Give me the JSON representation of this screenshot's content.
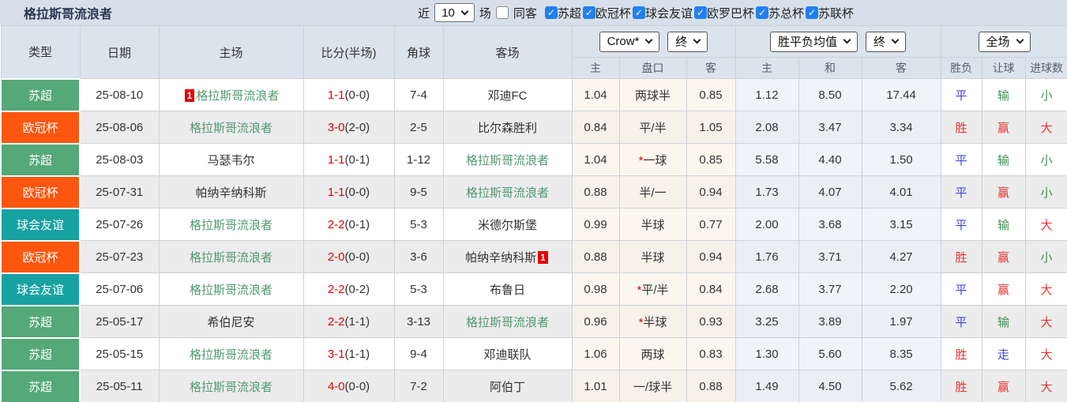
{
  "toolbar": {
    "title": "格拉斯哥流浪者",
    "near_label": "近",
    "match_count": "10",
    "games_label": "场",
    "same_away_label": "同客",
    "filters": [
      {
        "label": "苏超",
        "checked": true
      },
      {
        "label": "欧冠杯",
        "checked": true
      },
      {
        "label": "球会友谊",
        "checked": true
      },
      {
        "label": "欧罗巴杯",
        "checked": true
      },
      {
        "label": "苏总杯",
        "checked": true
      },
      {
        "label": "苏联杯",
        "checked": true
      }
    ]
  },
  "header": {
    "col_type": "类型",
    "col_date": "日期",
    "col_home": "主场",
    "col_score": "比分(半场)",
    "col_corner": "角球",
    "col_away": "客场",
    "odds_dropdown": "Crow*",
    "odds_final": "终",
    "mean_dropdown": "胜平负均值",
    "mean_final": "终",
    "full_dropdown": "全场",
    "odds_sub": [
      "主",
      "盘口",
      "客"
    ],
    "mean_sub": [
      "主",
      "和",
      "客"
    ],
    "result_sub": [
      "胜负",
      "让球",
      "进球数"
    ]
  },
  "colors": {
    "accent_checkbox": "#2180f0",
    "team_green": "#52996f",
    "score_red": "#e60000",
    "result_red": "#e83333",
    "result_blue": "#4343e0",
    "result_green": "#3f9150"
  },
  "rows": [
    {
      "type": "苏超",
      "type_color": "#55a878",
      "date": "25-08-10",
      "home": "格拉斯哥流浪者",
      "home_is_team": true,
      "home_mark": "1",
      "score": "1-1",
      "half": "(0-0)",
      "corners": "7-4",
      "away": "邓迪FC",
      "away_is_team": false,
      "away_mark": null,
      "odds_home": "1.04",
      "handicap": "两球半",
      "handicap_star": false,
      "odds_away": "0.85",
      "mean_home": "1.12",
      "mean_draw": "8.50",
      "mean_away": "17.44",
      "res_outcome": {
        "text": "平",
        "color": "blue"
      },
      "res_handicap": {
        "text": "输",
        "color": "green"
      },
      "res_goals": {
        "text": "小",
        "color": "green"
      }
    },
    {
      "type": "欧冠杯",
      "type_color": "#fd560e",
      "date": "25-08-06",
      "home": "格拉斯哥流浪者",
      "home_is_team": true,
      "home_mark": null,
      "score": "3-0",
      "half": "(2-0)",
      "corners": "2-5",
      "away": "比尔森胜利",
      "away_is_team": false,
      "away_mark": null,
      "odds_home": "0.84",
      "handicap": "平/半",
      "handicap_star": false,
      "odds_away": "1.05",
      "mean_home": "2.08",
      "mean_draw": "3.47",
      "mean_away": "3.34",
      "res_outcome": {
        "text": "胜",
        "color": "red"
      },
      "res_handicap": {
        "text": "赢",
        "color": "red"
      },
      "res_goals": {
        "text": "大",
        "color": "red"
      }
    },
    {
      "type": "苏超",
      "type_color": "#55a878",
      "date": "25-08-03",
      "home": "马瑟韦尔",
      "home_is_team": false,
      "home_mark": null,
      "score": "1-1",
      "half": "(0-1)",
      "corners": "1-12",
      "away": "格拉斯哥流浪者",
      "away_is_team": true,
      "away_mark": null,
      "odds_home": "1.04",
      "handicap": "一球",
      "handicap_star": true,
      "odds_away": "0.85",
      "mean_home": "5.58",
      "mean_draw": "4.40",
      "mean_away": "1.50",
      "res_outcome": {
        "text": "平",
        "color": "blue"
      },
      "res_handicap": {
        "text": "输",
        "color": "green"
      },
      "res_goals": {
        "text": "小",
        "color": "green"
      }
    },
    {
      "type": "欧冠杯",
      "type_color": "#fd560e",
      "date": "25-07-31",
      "home": "帕纳辛纳科斯",
      "home_is_team": false,
      "home_mark": null,
      "score": "1-1",
      "half": "(0-0)",
      "corners": "9-5",
      "away": "格拉斯哥流浪者",
      "away_is_team": true,
      "away_mark": null,
      "odds_home": "0.88",
      "handicap": "半/一",
      "handicap_star": false,
      "odds_away": "0.94",
      "mean_home": "1.73",
      "mean_draw": "4.07",
      "mean_away": "4.01",
      "res_outcome": {
        "text": "平",
        "color": "blue"
      },
      "res_handicap": {
        "text": "赢",
        "color": "red"
      },
      "res_goals": {
        "text": "小",
        "color": "green"
      }
    },
    {
      "type": "球会友谊",
      "type_color": "#17a2a2",
      "date": "25-07-26",
      "home": "格拉斯哥流浪者",
      "home_is_team": true,
      "home_mark": null,
      "score": "2-2",
      "half": "(0-1)",
      "corners": "5-3",
      "away": "米德尔斯堡",
      "away_is_team": false,
      "away_mark": null,
      "odds_home": "0.99",
      "handicap": "半球",
      "handicap_star": false,
      "odds_away": "0.77",
      "mean_home": "2.00",
      "mean_draw": "3.68",
      "mean_away": "3.15",
      "res_outcome": {
        "text": "平",
        "color": "blue"
      },
      "res_handicap": {
        "text": "输",
        "color": "green"
      },
      "res_goals": {
        "text": "大",
        "color": "red"
      }
    },
    {
      "type": "欧冠杯",
      "type_color": "#fd560e",
      "date": "25-07-23",
      "home": "格拉斯哥流浪者",
      "home_is_team": true,
      "home_mark": null,
      "score": "2-0",
      "half": "(0-0)",
      "corners": "3-6",
      "away": "帕纳辛纳科斯",
      "away_is_team": false,
      "away_mark": "1",
      "odds_home": "0.88",
      "handicap": "半球",
      "handicap_star": false,
      "odds_away": "0.94",
      "mean_home": "1.76",
      "mean_draw": "3.71",
      "mean_away": "4.27",
      "res_outcome": {
        "text": "胜",
        "color": "red"
      },
      "res_handicap": {
        "text": "赢",
        "color": "red"
      },
      "res_goals": {
        "text": "小",
        "color": "green"
      }
    },
    {
      "type": "球会友谊",
      "type_color": "#17a2a2",
      "date": "25-07-06",
      "home": "格拉斯哥流浪者",
      "home_is_team": true,
      "home_mark": null,
      "score": "2-2",
      "half": "(0-2)",
      "corners": "5-3",
      "away": "布鲁日",
      "away_is_team": false,
      "away_mark": null,
      "odds_home": "0.98",
      "handicap": "平/半",
      "handicap_star": true,
      "odds_away": "0.84",
      "mean_home": "2.68",
      "mean_draw": "3.77",
      "mean_away": "2.20",
      "res_outcome": {
        "text": "平",
        "color": "blue"
      },
      "res_handicap": {
        "text": "赢",
        "color": "red"
      },
      "res_goals": {
        "text": "大",
        "color": "red"
      }
    },
    {
      "type": "苏超",
      "type_color": "#55a878",
      "date": "25-05-17",
      "home": "希伯尼安",
      "home_is_team": false,
      "home_mark": null,
      "score": "2-2",
      "half": "(1-1)",
      "corners": "3-13",
      "away": "格拉斯哥流浪者",
      "away_is_team": true,
      "away_mark": null,
      "odds_home": "0.96",
      "handicap": "半球",
      "handicap_star": true,
      "odds_away": "0.93",
      "mean_home": "3.25",
      "mean_draw": "3.89",
      "mean_away": "1.97",
      "res_outcome": {
        "text": "平",
        "color": "blue"
      },
      "res_handicap": {
        "text": "输",
        "color": "green"
      },
      "res_goals": {
        "text": "大",
        "color": "red"
      }
    },
    {
      "type": "苏超",
      "type_color": "#55a878",
      "date": "25-05-15",
      "home": "格拉斯哥流浪者",
      "home_is_team": true,
      "home_mark": null,
      "score": "3-1",
      "half": "(1-1)",
      "corners": "9-4",
      "away": "邓迪联队",
      "away_is_team": false,
      "away_mark": null,
      "odds_home": "1.06",
      "handicap": "两球",
      "handicap_star": false,
      "odds_away": "0.83",
      "mean_home": "1.30",
      "mean_draw": "5.60",
      "mean_away": "8.35",
      "res_outcome": {
        "text": "胜",
        "color": "red"
      },
      "res_handicap": {
        "text": "走",
        "color": "blue"
      },
      "res_goals": {
        "text": "大",
        "color": "red"
      }
    },
    {
      "type": "苏超",
      "type_color": "#55a878",
      "date": "25-05-11",
      "home": "格拉斯哥流浪者",
      "home_is_team": true,
      "home_mark": null,
      "score": "4-0",
      "half": "(0-0)",
      "corners": "7-2",
      "away": "阿伯丁",
      "away_is_team": false,
      "away_mark": null,
      "odds_home": "1.01",
      "handicap": "一/球半",
      "handicap_star": false,
      "odds_away": "0.88",
      "mean_home": "1.49",
      "mean_draw": "4.50",
      "mean_away": "5.62",
      "res_outcome": {
        "text": "胜",
        "color": "red"
      },
      "res_handicap": {
        "text": "赢",
        "color": "red"
      },
      "res_goals": {
        "text": "大",
        "color": "red"
      }
    }
  ]
}
